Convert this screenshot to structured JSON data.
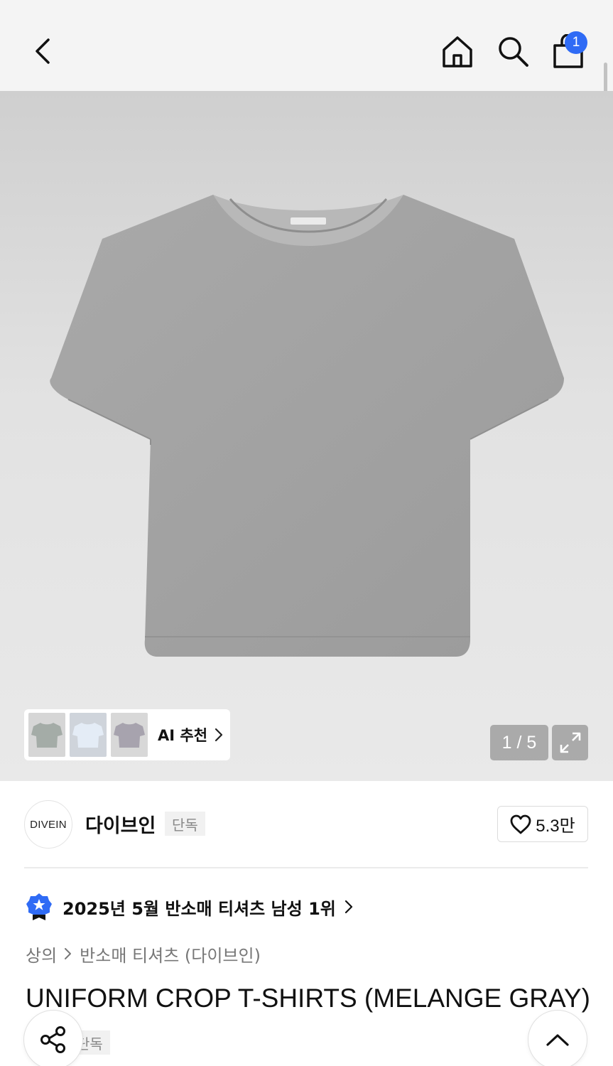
{
  "header": {
    "back_icon": "chevron-left-icon",
    "home_icon": "home-icon",
    "search_icon": "search-icon",
    "cart_icon": "shopping-bag-icon",
    "cart_count": "1",
    "badge_color": "#2f6bf5"
  },
  "gallery": {
    "ai_label": "AI 추천",
    "counter": "1 / 5",
    "expand_icon": "expand-icon"
  },
  "brand": {
    "logo_text": "DIVEIN",
    "name": "다이브인",
    "tag": "단독",
    "like_count": "5.3만"
  },
  "ranking": {
    "text": "2025년 5월 반소매 티셔츠 남성 1위"
  },
  "breadcrumb": {
    "level1": "상의",
    "level2": "반소매 티셔츠 (다이브인)"
  },
  "product": {
    "title": "UNIFORM CROP T-SHIRTS (MELANGE GRAY)",
    "tag": "단독"
  },
  "floating": {
    "share_icon": "share-icon",
    "top_icon": "chevron-up-icon"
  }
}
